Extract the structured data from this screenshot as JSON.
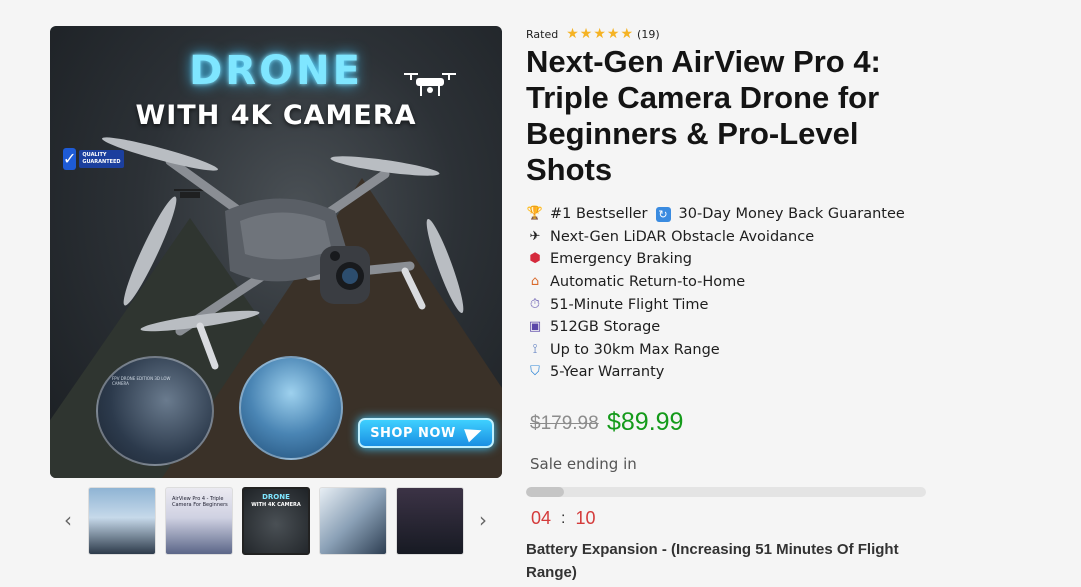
{
  "gallery": {
    "main_image": {
      "headline": "DRONE",
      "subheadline": "WITH 4K CAMERA",
      "badge_text": "QUALITY GUARANTEED",
      "circle_caption": "FPV DRONE EDITION 3D LOW CAMERA",
      "cta_label": "SHOP NOW"
    },
    "prev_arrow": "‹",
    "next_arrow": "›",
    "thumbnails": [
      {
        "alt": "Drone controller thumbnail"
      },
      {
        "alt": "AirView Pro 4",
        "caption": "AirView Pro 4 - Triple Camera For Beginners"
      },
      {
        "alt": "Drone with 4K camera",
        "caption": "DRONE",
        "caption2": "WITH 4K CAMERA"
      },
      {
        "alt": "Aerial mountain shot"
      },
      {
        "alt": "Drone specs infographic"
      }
    ]
  },
  "product": {
    "rating_label": "Rated",
    "rating_value": 5,
    "review_count": "(19)",
    "title": "Next-Gen AirView Pro 4: Triple Camera Drone for Beginners & Pro-Level Shots",
    "features": [
      {
        "icon": "trophy-icon",
        "text": "#1 Bestseller",
        "extra_icon": "refresh-icon",
        "extra_text": "30-Day Money Back Guarantee"
      },
      {
        "icon": "airplane-icon",
        "text": "Next-Gen LiDAR Obstacle Avoidance"
      },
      {
        "icon": "stop-sign-icon",
        "text": "Emergency Braking"
      },
      {
        "icon": "home-icon",
        "text": "Automatic Return-to-Home"
      },
      {
        "icon": "stopwatch-icon",
        "text": "51-Minute Flight Time"
      },
      {
        "icon": "floppy-disk-icon",
        "text": "512GB Storage"
      },
      {
        "icon": "satellite-icon",
        "text": "Up to 30km Max Range"
      },
      {
        "icon": "shield-icon",
        "text": "5-Year Warranty"
      }
    ],
    "old_price": "$179.98",
    "new_price": "$89.99",
    "sale_label": "Sale ending in",
    "sale_progress": 0.095,
    "countdown": {
      "minutes": "04",
      "separator": ":",
      "seconds": "10"
    },
    "option_title": "Battery Expansion - (Increasing 51 Minutes Of Flight Range)"
  },
  "colors": {
    "accent_price": "#149a1a",
    "countdown": "#d43b3b",
    "star": "#f5b324",
    "headline_glow": "#7fe6ff"
  }
}
